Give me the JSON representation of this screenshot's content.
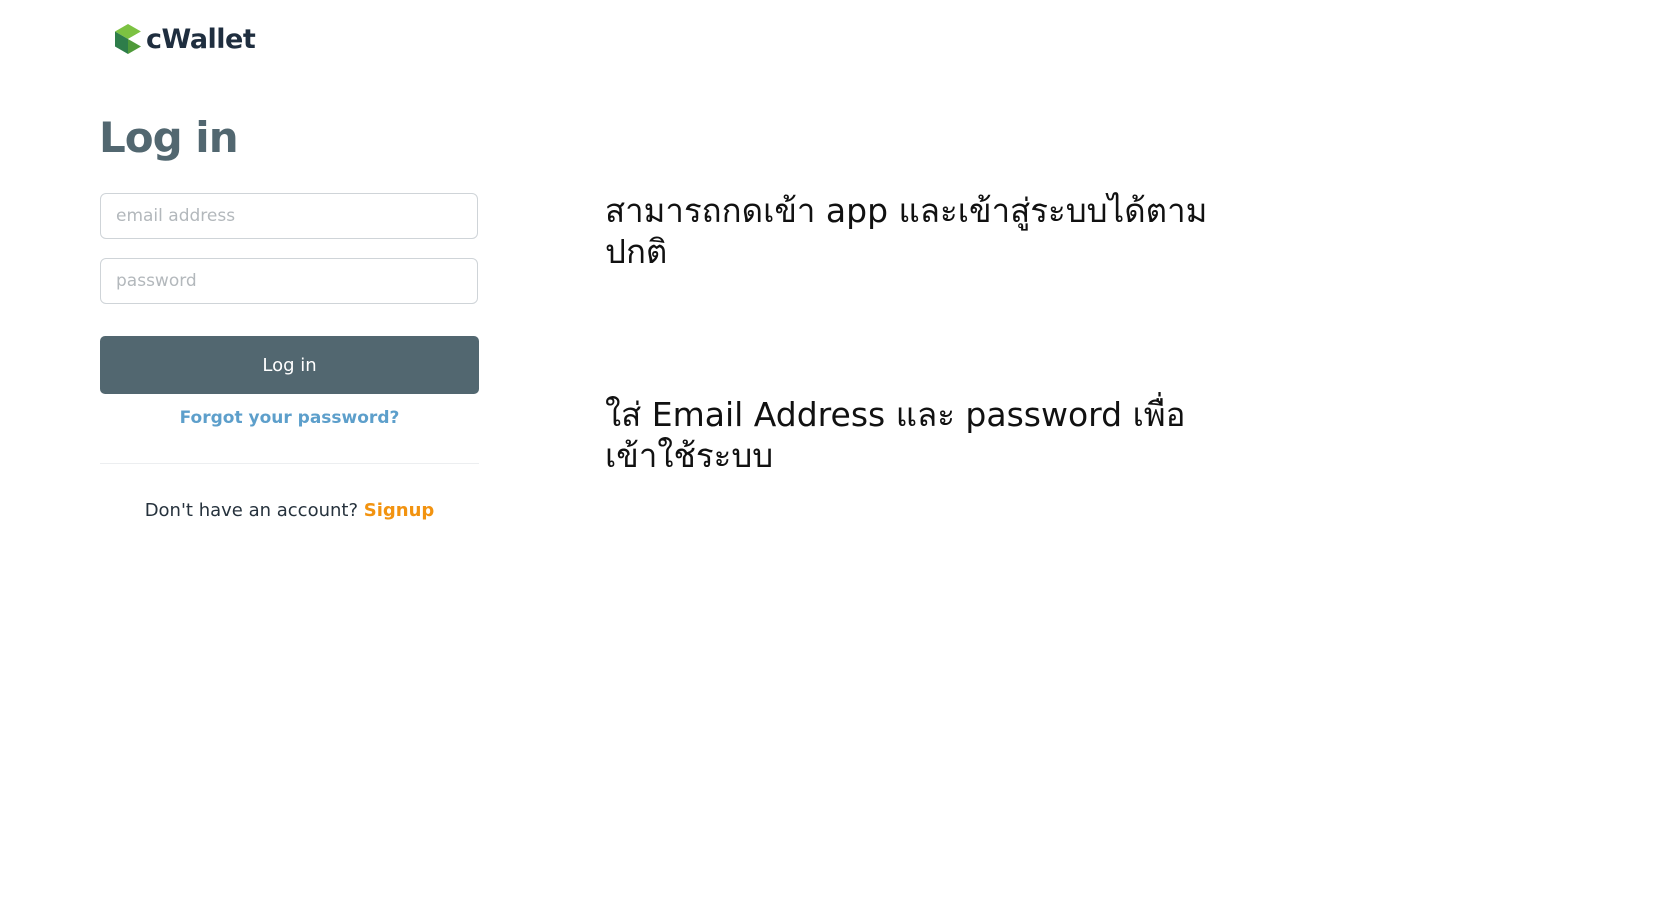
{
  "brand": {
    "name": "cWallet",
    "icon": "hexagon-chevron-logo",
    "colors": {
      "dark_green": "#2e7d4a",
      "light_green": "#7cc242",
      "text": "#1f2e3f"
    }
  },
  "login": {
    "title": "Log in",
    "email_placeholder": "email address",
    "password_placeholder": "password",
    "submit_label": "Log in",
    "forgot_label": "Forgot your password?",
    "signup_prompt": "Don't have an account?",
    "signup_label": "Signup"
  },
  "notes": {
    "note1": "สามารถกดเข้า app และเข้าสู่ระบบได้ตามปกติ",
    "note2": "ใส่ Email Address และ password เพื่อเข้าใช้ระบบ"
  },
  "colors": {
    "primary": "#526770",
    "link_blue": "#5d9fcb",
    "accent_orange": "#f29310"
  }
}
